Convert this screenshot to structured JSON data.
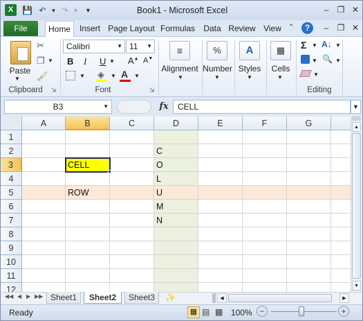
{
  "window": {
    "title": "Book1  -  Microsoft Excel"
  },
  "ribbon_tabs": [
    "File",
    "Home",
    "Insert",
    "Page Layout",
    "Formulas",
    "Data",
    "Review",
    "View"
  ],
  "font": {
    "name": "Calibri",
    "size": "11"
  },
  "groups": {
    "clipboard": "Clipboard",
    "font": "Font",
    "editing": "Editing",
    "paste": "Paste",
    "alignment": "Alignment",
    "number": "Number",
    "styles": "Styles",
    "cells": "Cells"
  },
  "formula_bar": {
    "name_box": "B3",
    "fx": "fx",
    "content": "CELL"
  },
  "columns": [
    "A",
    "B",
    "C",
    "D",
    "E",
    "F",
    "G"
  ],
  "rows": [
    "1",
    "2",
    "3",
    "4",
    "5",
    "6",
    "7",
    "8",
    "9",
    "10",
    "11",
    "12"
  ],
  "cells": {
    "B3": "CELL",
    "B5": "ROW",
    "D2": "C",
    "D3": "O",
    "D4": "L",
    "D5": "U",
    "D6": "M",
    "D7": "N"
  },
  "sheets": [
    "Sheet1",
    "Sheet2",
    "Sheet3"
  ],
  "active_sheet": "Sheet2",
  "status": {
    "mode": "Ready",
    "zoom": "100%"
  },
  "colors": {
    "selected_cell_fill": "#ffff00",
    "row_highlight": "#fde9d9",
    "column_highlight": "#ebf1de",
    "file_tab": "#1e7a2e"
  }
}
